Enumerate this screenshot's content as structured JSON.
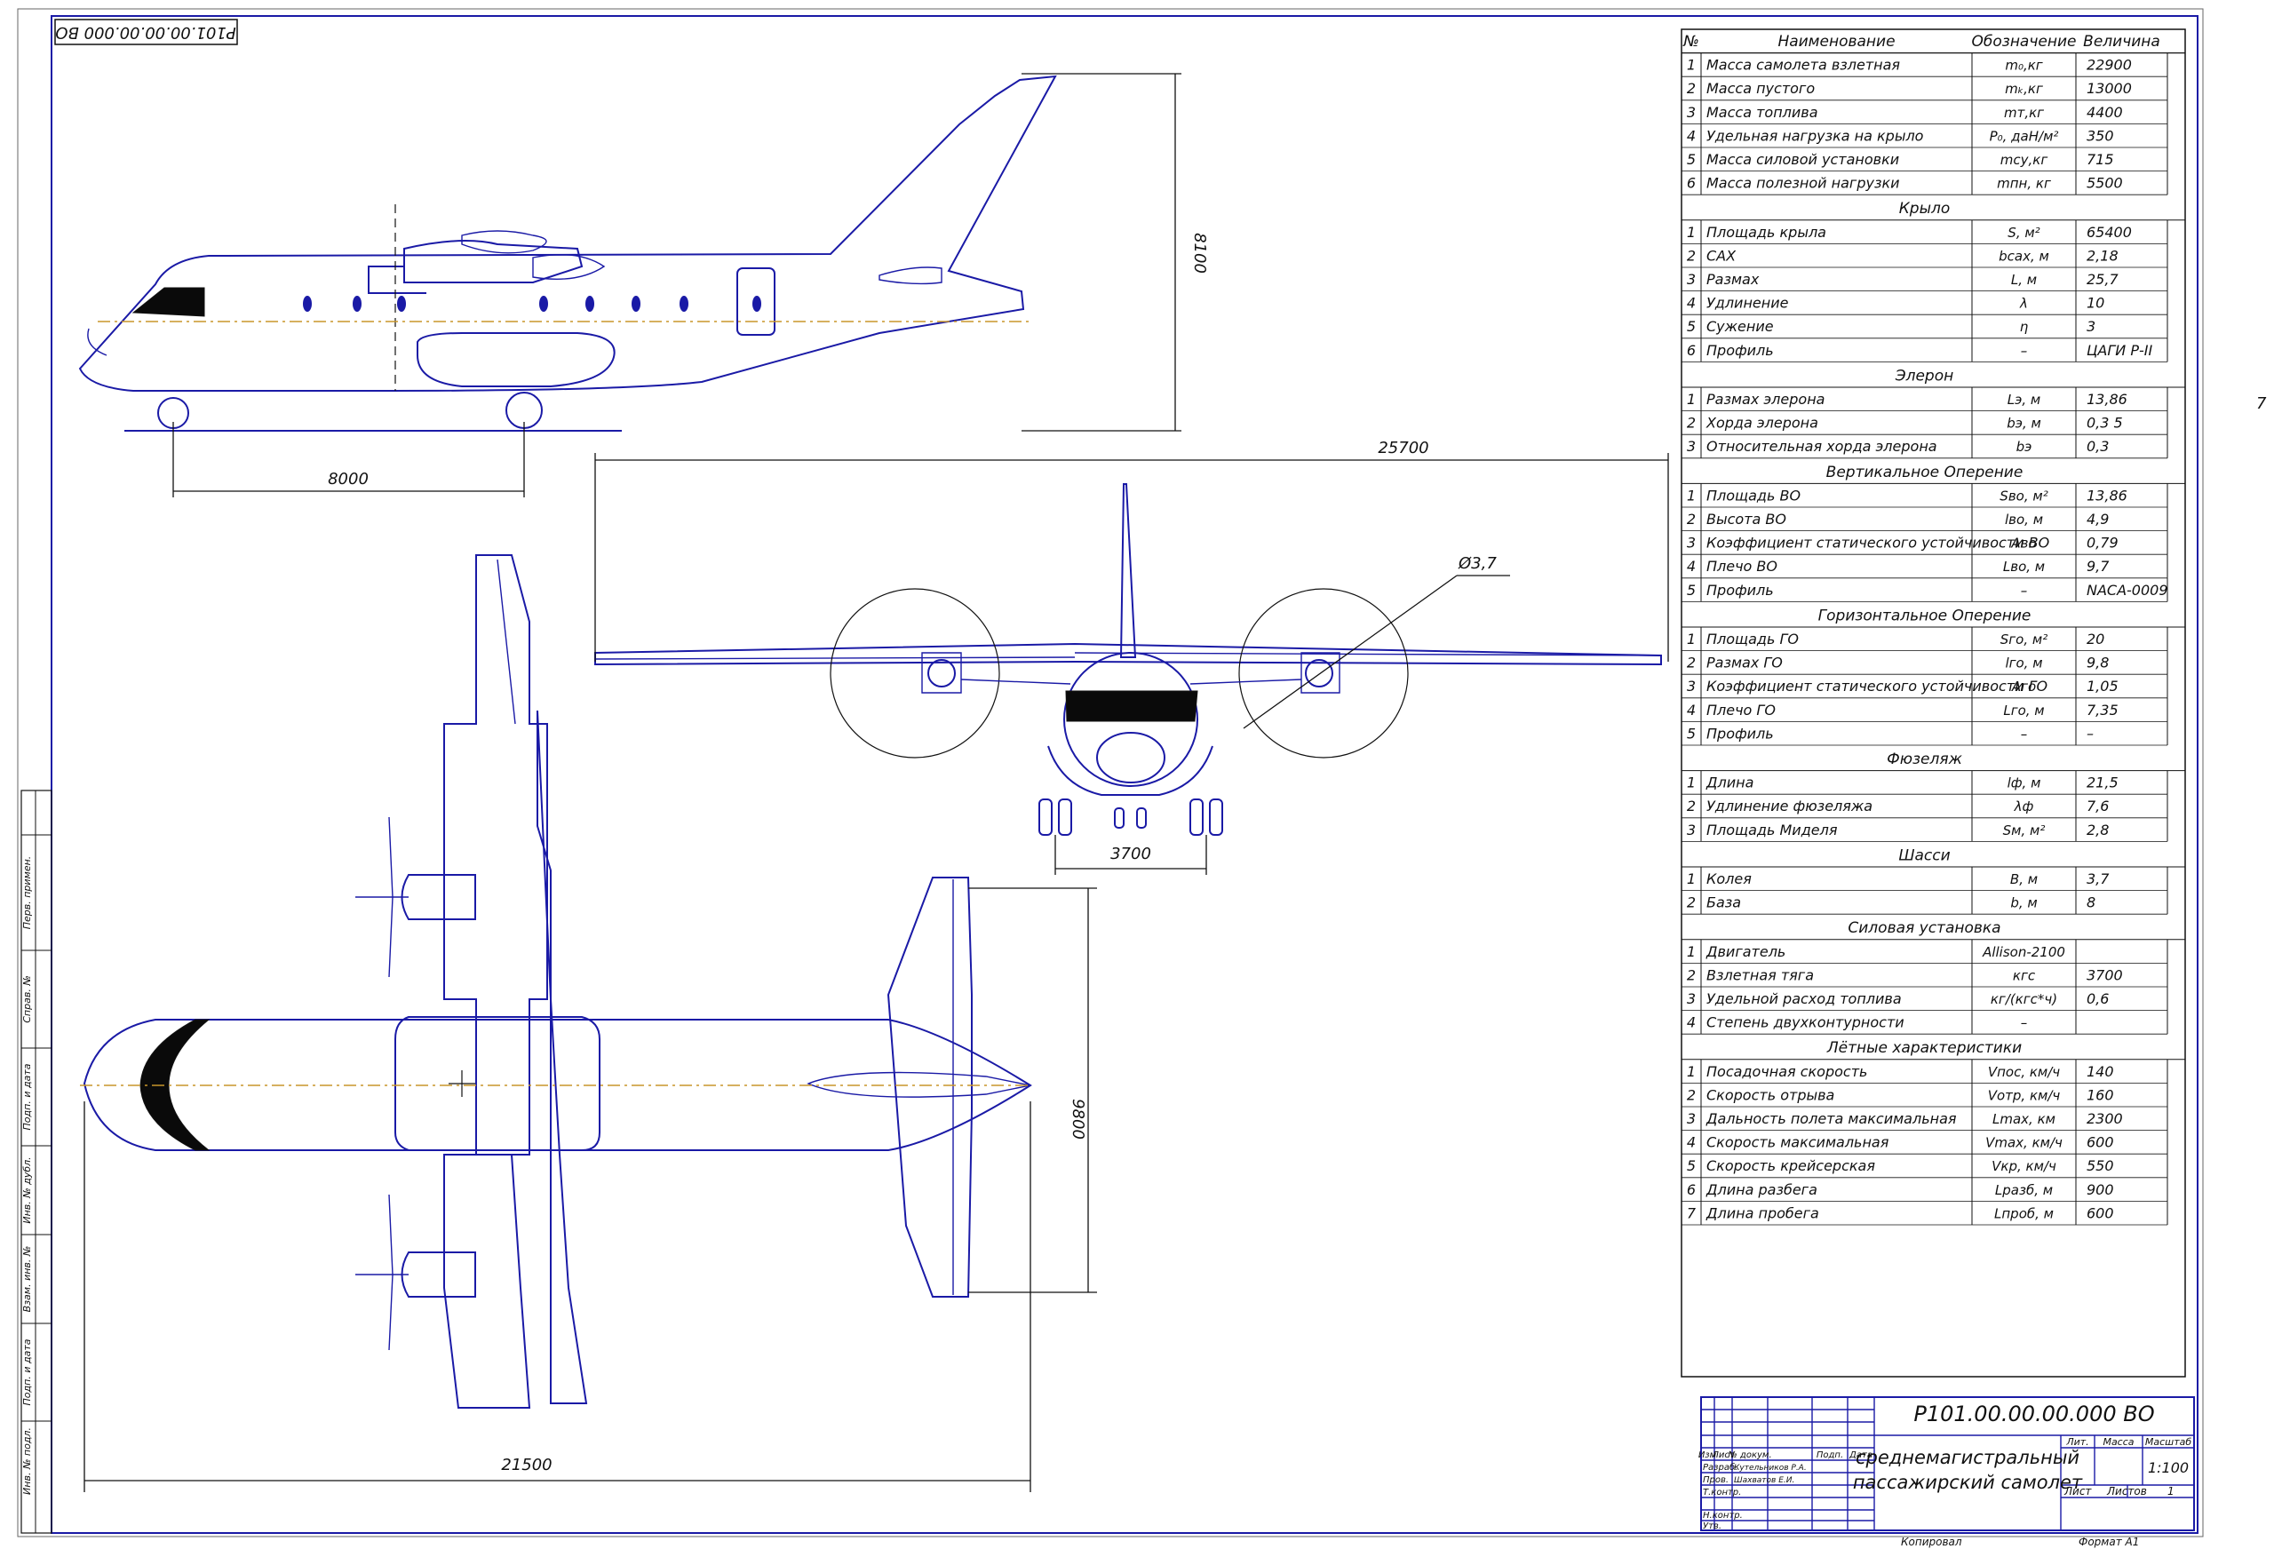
{
  "doc_code_top": "Р101.00.00.00.000 ВО",
  "page_marker": "7",
  "dimensions": {
    "height": "8100",
    "wheelbase": "8000",
    "span": "25700",
    "prop_diameter": "Ø3,7",
    "track": "3700",
    "tail_span": "9800",
    "length": "21500"
  },
  "side_stamp": [
    "Перв. примен.",
    "Справ. №",
    "Подп. и дата",
    "Инв. № дубл.",
    "Взам. инв. №",
    "Подп. и дата",
    "Инв. № подл."
  ],
  "table": {
    "headers": [
      "№",
      "Наименование",
      "Обозначение",
      "Величина"
    ],
    "sections": [
      {
        "title": "",
        "rows": [
          [
            "1",
            "Масса самолета взлетная",
            "m₀,кг",
            "22900"
          ],
          [
            "2",
            "Масса пустого",
            "mₖ,кг",
            "13000"
          ],
          [
            "3",
            "Масса топлива",
            "mт,кг",
            "4400"
          ],
          [
            "4",
            "Удельная нагрузка на крыло",
            "P₀, даН/м²",
            "350"
          ],
          [
            "5",
            "Масса силовой установки",
            "mсу,кг",
            "715"
          ],
          [
            "6",
            "Масса полезной нагрузки",
            "mпн, кг",
            "5500"
          ]
        ]
      },
      {
        "title": "Крыло",
        "rows": [
          [
            "1",
            "Площадь крыла",
            "S, м²",
            "65400"
          ],
          [
            "2",
            "САХ",
            "bсах, м",
            "2,18"
          ],
          [
            "3",
            "Размах",
            "L, м",
            "25,7"
          ],
          [
            "4",
            "Удлинение",
            "λ",
            "10"
          ],
          [
            "5",
            "Сужение",
            "η",
            "3"
          ],
          [
            "6",
            "Профиль",
            "–",
            "ЦАГИ Р-II"
          ]
        ]
      },
      {
        "title": "Элерон",
        "rows": [
          [
            "1",
            "Размах элерона",
            "Lэ, м",
            "13,86"
          ],
          [
            "2",
            "Хорда элерона",
            "bэ, м",
            "0,3 5"
          ],
          [
            "3",
            "Относительная хорда элерона",
            "bэ",
            "0,3"
          ]
        ]
      },
      {
        "title": "Вертикальное Оперение",
        "rows": [
          [
            "1",
            "Площадь ВО",
            "Sво, м²",
            "13,86"
          ],
          [
            "2",
            "Высота ВО",
            "lво, м",
            "4,9"
          ],
          [
            "3",
            "Коэффициент статического устойчивости ВО",
            "Aво",
            "0,79"
          ],
          [
            "4",
            "Плечо ВО",
            "Lво, м",
            "9,7"
          ],
          [
            "5",
            "Профиль",
            "–",
            "NACA-0009"
          ]
        ]
      },
      {
        "title": "Горизонтальное Оперение",
        "rows": [
          [
            "1",
            "Площадь ГО",
            "Sго, м²",
            "20"
          ],
          [
            "2",
            "Размах ГО",
            "lго, м",
            "9,8"
          ],
          [
            "3",
            "Коэффициент статического устойчивости ГО",
            "Aго",
            "1,05"
          ],
          [
            "4",
            "Плечо ГО",
            "Lго, м",
            "7,35"
          ],
          [
            "5",
            "Профиль",
            "–",
            "–"
          ]
        ]
      },
      {
        "title": "Фюзеляж",
        "rows": [
          [
            "1",
            "Длина",
            "lф, м",
            "21,5"
          ],
          [
            "2",
            "Удлинение фюзеляжа",
            "λф",
            "7,6"
          ],
          [
            "3",
            "Площадь Миделя",
            "Sм, м²",
            "2,8"
          ]
        ]
      },
      {
        "title": "Шасси",
        "rows": [
          [
            "1",
            "Колея",
            "B, м",
            "3,7"
          ],
          [
            "2",
            "База",
            "b, м",
            "8"
          ]
        ]
      },
      {
        "title": "Силовая установка",
        "rows": [
          [
            "1",
            "Двигатель",
            "Allison-2100",
            ""
          ],
          [
            "2",
            "Взлетная тяга",
            "кгс",
            "3700"
          ],
          [
            "3",
            "Удельной расход топлива",
            "кг/(кгс*ч)",
            "0,6"
          ],
          [
            "4",
            "Степень двухконтурности",
            "–",
            ""
          ]
        ]
      },
      {
        "title": "Лётные характеристики",
        "rows": [
          [
            "1",
            "Посадочная скорость",
            "Vпос, км/ч",
            "140"
          ],
          [
            "2",
            "Скорость отрыва",
            "Vотр, км/ч",
            "160"
          ],
          [
            "3",
            "Дальность полета максимальная",
            "Lmax, км",
            "2300"
          ],
          [
            "4",
            "Скорость максимальная",
            "Vmax, км/ч",
            "600"
          ],
          [
            "5",
            "Скорость крейсерская",
            "Vкр, км/ч",
            "550"
          ],
          [
            "6",
            "Длина разбега",
            "Lразб, м",
            "900"
          ],
          [
            "7",
            "Длина пробега",
            "Lпроб, м",
            "600"
          ]
        ]
      }
    ]
  },
  "title_block": {
    "doc_code": "Р101.00.00.00.000 ВО",
    "title_line1": "среднемагистральный",
    "title_line2": "пассажирский самолет",
    "col_headers": [
      "Изм",
      "Лист",
      "№ докум.",
      "Подп.",
      "Дата"
    ],
    "roles": [
      "Разраб.",
      "Пров.",
      "Т.контр.",
      "",
      "Н.контр.",
      "Утв."
    ],
    "names": [
      "Кутельников Р.А.",
      "Шахватов Е.И."
    ],
    "lit_label": "Лит.",
    "mass_label": "Масса",
    "scale_label": "Масштаб",
    "scale": "1:100",
    "sheet_label": "Лист",
    "sheets_label": "Листов",
    "sheets_count": "1",
    "copied": "Копировал",
    "format": "Формат  А1"
  }
}
